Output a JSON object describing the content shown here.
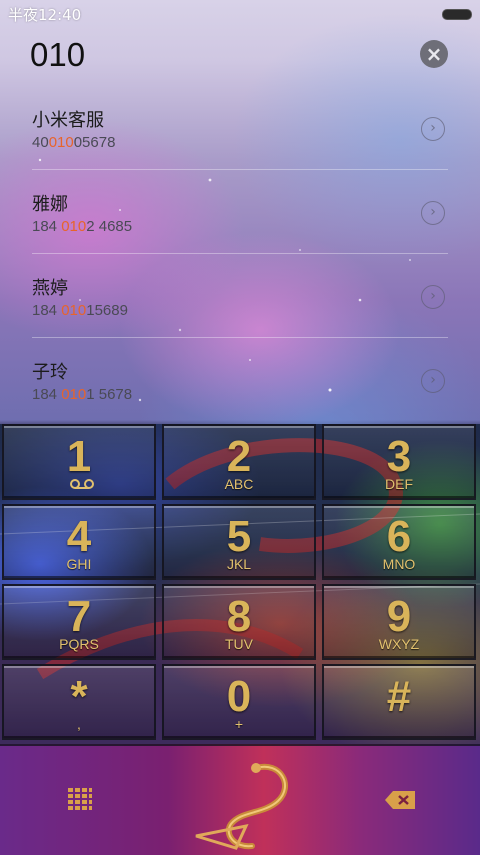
{
  "status_bar": {
    "time": "半夜12:40"
  },
  "search": {
    "query": "010",
    "clear_icon": "close-icon"
  },
  "results": [
    {
      "name": "小米客服",
      "num_before": "40",
      "num_match": "010",
      "num_after": "05678"
    },
    {
      "name": "雅娜",
      "num_before": "184 ",
      "num_match": "010",
      "num_after": "2 4685"
    },
    {
      "name": "燕婷",
      "num_before": "184 ",
      "num_match": "010",
      "num_after": "15689"
    },
    {
      "name": "子玲",
      "num_before": "184 ",
      "num_match": "010",
      "num_after": "1 5678"
    }
  ],
  "keys": [
    {
      "digit": "1",
      "letters": ""
    },
    {
      "digit": "2",
      "letters": "ABC"
    },
    {
      "digit": "3",
      "letters": "DEF"
    },
    {
      "digit": "4",
      "letters": "GHI"
    },
    {
      "digit": "5",
      "letters": "JKL"
    },
    {
      "digit": "6",
      "letters": "MNO"
    },
    {
      "digit": "7",
      "letters": "PQRS"
    },
    {
      "digit": "8",
      "letters": "TUV"
    },
    {
      "digit": "9",
      "letters": "WXYZ"
    },
    {
      "digit": "*",
      "letters": ","
    },
    {
      "digit": "0",
      "letters": "+"
    },
    {
      "digit": "#",
      "letters": ""
    }
  ],
  "bottom_bar": {
    "left_icon": "keypad-grid-icon",
    "center_icon": "dial-call-icon",
    "right_icon": "backspace-icon"
  },
  "colors": {
    "highlight": "#e8642a",
    "key_gold": "#d9b45a"
  }
}
